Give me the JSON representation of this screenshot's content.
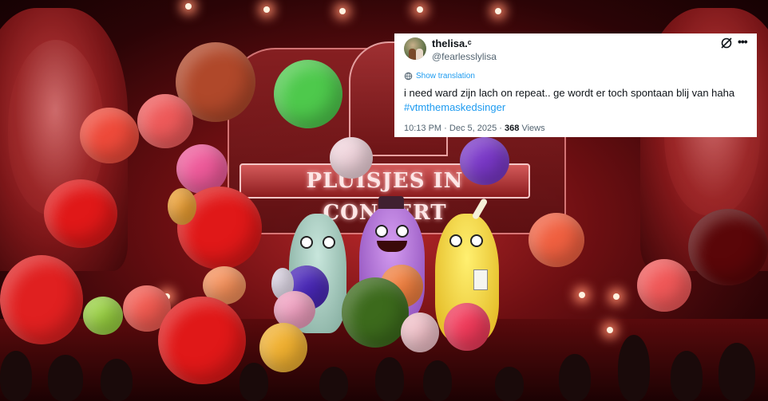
{
  "photo": {
    "stage_sign": "PLUISJES IN CONCERT"
  },
  "tweet": {
    "display_name": "thelisa.ᶜ",
    "handle": "@fearlesslylisa",
    "show_translation": "Show translation",
    "text": "i need ward zijn lach on repeat.. ge wordt er toch spontaan blij van haha",
    "hashtag": "#vtmthemaskedsinger",
    "time": "10:13 PM",
    "separator": "·",
    "date": "Dec 5, 2025",
    "views_count": "368",
    "views_label": "Views"
  },
  "icons": {
    "avatar": "profile-photo",
    "grok": "grok-icon",
    "more": "more-horizontal-icon",
    "translate": "translate-icon"
  },
  "colors": {
    "link": "#1d9bf0",
    "text": "#0f1419",
    "secondary": "#536471",
    "card": "#ffffff"
  }
}
